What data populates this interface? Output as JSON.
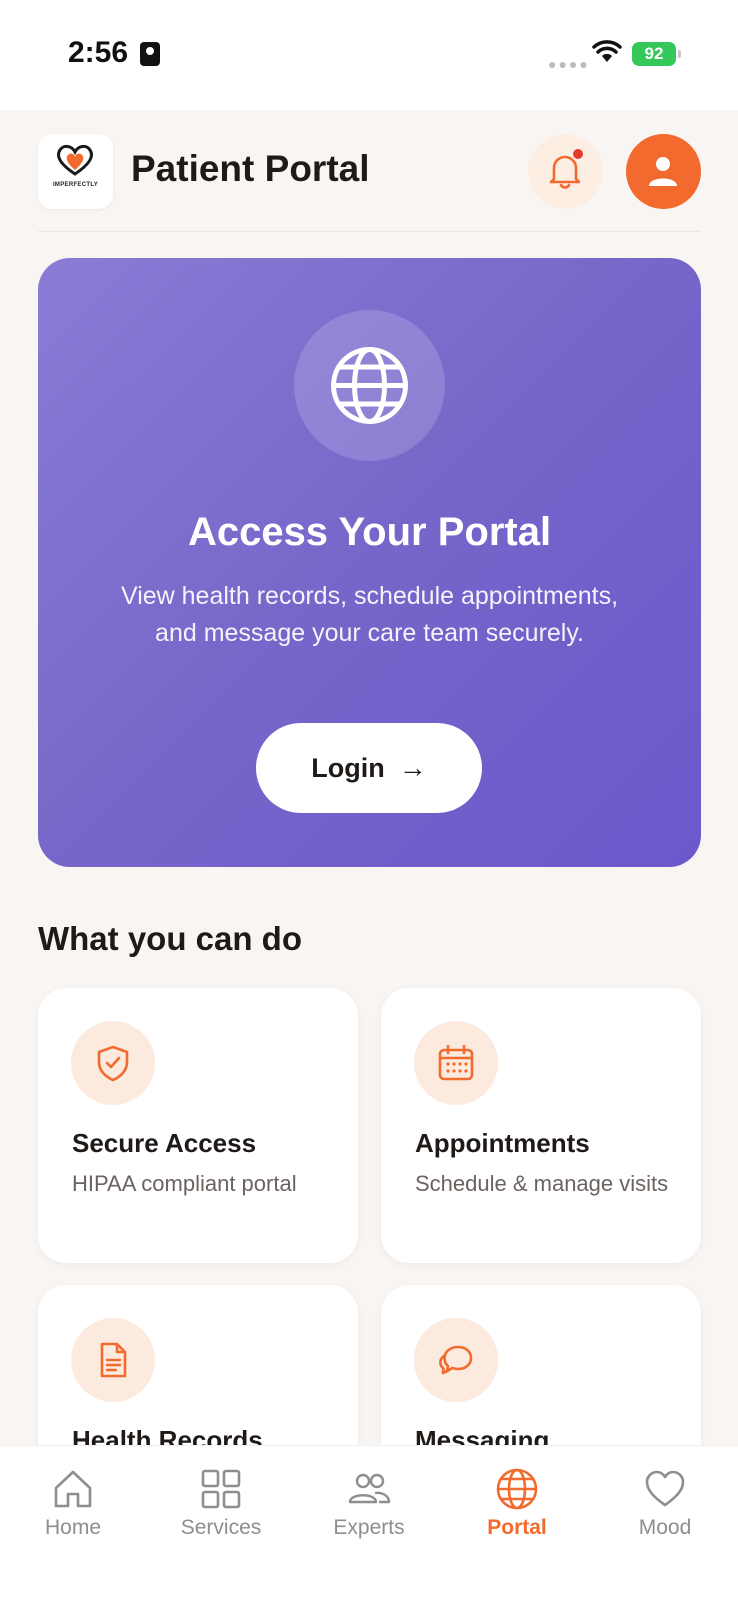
{
  "status_bar": {
    "time": "2:56",
    "battery": "92"
  },
  "header": {
    "title": "Patient Portal",
    "logo_text": "IMPERFECTLY"
  },
  "hero": {
    "title": "Access Your Portal",
    "description": "View health records, schedule appointments, and message your care team securely.",
    "login_label": "Login"
  },
  "section": {
    "title": "What you can do",
    "cards": [
      {
        "title": "Secure Access",
        "description": "HIPAA compliant portal",
        "icon": "shield-check-icon"
      },
      {
        "title": "Appointments",
        "description": "Schedule & manage visits",
        "icon": "calendar-icon"
      },
      {
        "title": "Health Records",
        "description": "",
        "icon": "document-icon"
      },
      {
        "title": "Messaging",
        "description": "",
        "icon": "chat-icon"
      }
    ]
  },
  "tab_bar": {
    "tabs": [
      {
        "label": "Home",
        "icon": "home-icon",
        "active": false
      },
      {
        "label": "Services",
        "icon": "grid-icon",
        "active": false
      },
      {
        "label": "Experts",
        "icon": "people-icon",
        "active": false
      },
      {
        "label": "Portal",
        "icon": "globe-icon",
        "active": true
      },
      {
        "label": "Mood",
        "icon": "heart-icon",
        "active": false
      }
    ]
  },
  "colors": {
    "accent": "#f26a2e",
    "hero_start": "#8a7cd6",
    "hero_end": "#6b58cb",
    "page_bg": "#f9f5f3"
  }
}
